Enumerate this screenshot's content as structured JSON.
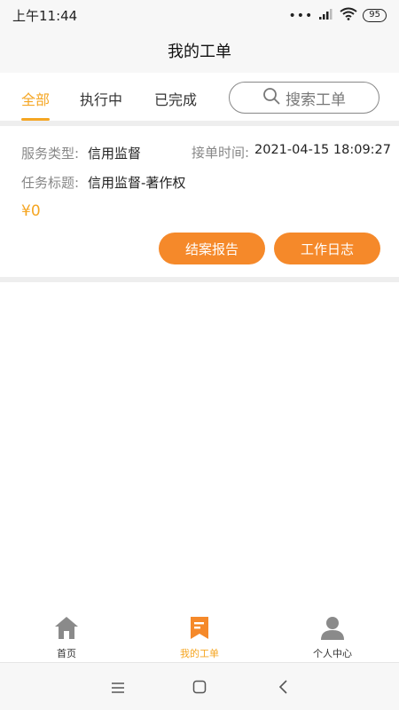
{
  "status_bar": {
    "time": "上午11:44",
    "dots": "•••",
    "battery": "95"
  },
  "header": {
    "title": "我的工单"
  },
  "tabs": [
    {
      "label": "全部",
      "active": true
    },
    {
      "label": "执行中",
      "active": false
    },
    {
      "label": "已完成",
      "active": false
    }
  ],
  "search": {
    "placeholder": "搜索工单"
  },
  "order": {
    "service_type_label": "服务类型:",
    "service_type_value": "信用监督",
    "accept_time_label": "接单时间:",
    "accept_time_value": "2021-04-15 18:09:27",
    "task_title_label": "任务标题:",
    "task_title_value": "信用监督-著作权",
    "price": "¥0",
    "buttons": {
      "report": "结案报告",
      "log": "工作日志"
    }
  },
  "bottom_nav": [
    {
      "label": "首页",
      "icon": "home-icon",
      "active": false
    },
    {
      "label": "我的工单",
      "icon": "order-icon",
      "active": true
    },
    {
      "label": "个人中心",
      "icon": "person-icon",
      "active": false
    }
  ],
  "colors": {
    "accent": "#f5a623",
    "button": "#f5892a"
  }
}
